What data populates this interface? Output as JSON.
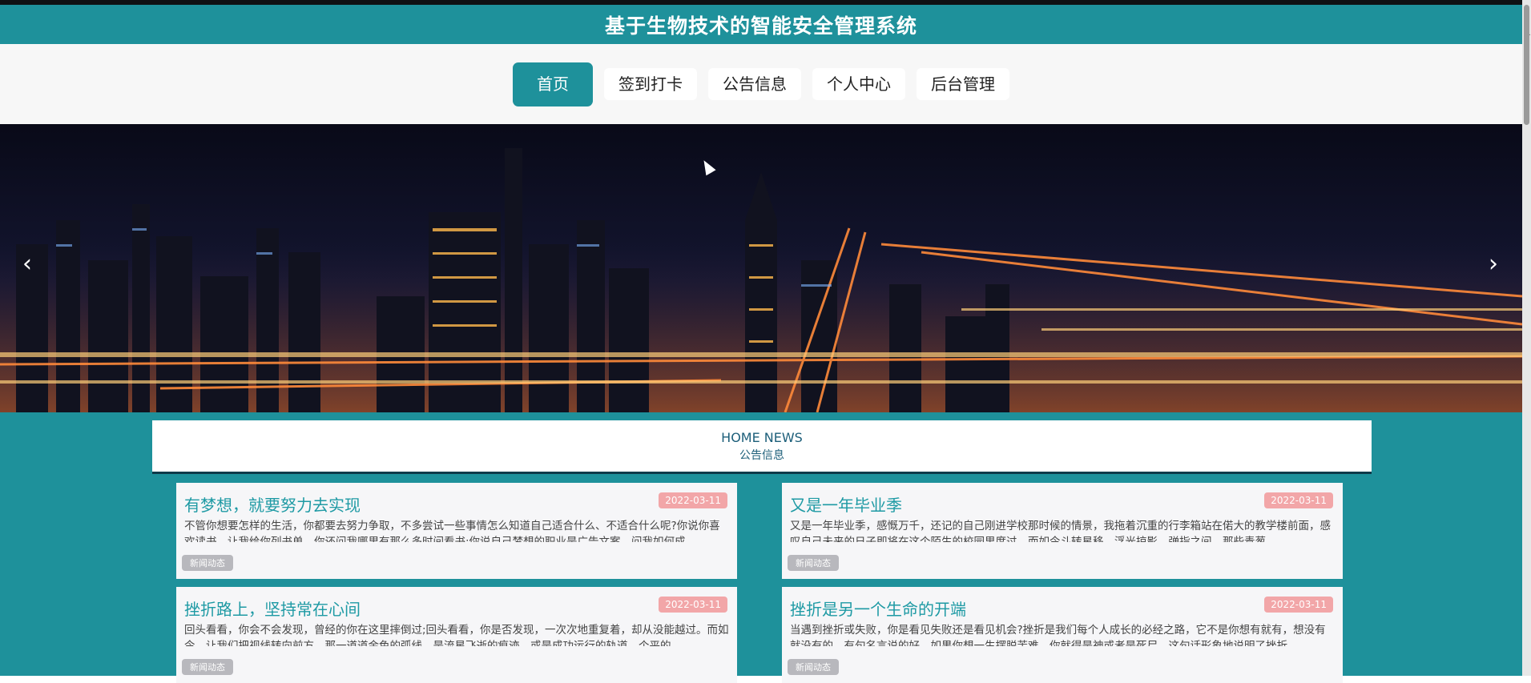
{
  "header": {
    "title": "基于生物技术的智能安全管理系统"
  },
  "nav": {
    "items": [
      {
        "label": "首页"
      },
      {
        "label": "签到打卡"
      },
      {
        "label": "公告信息"
      },
      {
        "label": "个人中心"
      },
      {
        "label": "后台管理"
      }
    ],
    "active_index": 0
  },
  "banner": {
    "prev_symbol": "‹",
    "next_symbol": "›"
  },
  "news": {
    "heading_en": "HOME NEWS",
    "heading_cn": "公告信息",
    "cards": [
      {
        "title": "有梦想，就要努力去实现",
        "date": "2022-03-11",
        "text": "不管你想要怎样的生活，你都要去努力争取，不多尝试一些事情怎么知道自己适合什么、不适合什么呢?你说你喜欢读书，让我给你列书单，你还问我哪里有那么多时间看书;你说自己梦想的职业是广告文案，问我如何成",
        "tag": "新闻动态"
      },
      {
        "title": "又是一年毕业季",
        "date": "2022-03-11",
        "text": "又是一年毕业季，感慨万千，还记的自己刚进学校那时候的情景，我拖着沉重的行李箱站在偌大的教学楼前面，感叹自己未来的日子即将在这个陌生的校园里度过，而如今斗转星移，浮光掠影，弹指之间，那些青葱",
        "tag": "新闻动态"
      },
      {
        "title": "挫折路上，坚持常在心间",
        "date": "2022-03-11",
        "text": "回头看看，你会不会发现，曾经的你在这里摔倒过;回头看看，你是否发现，一次次地重复着，却从没能越过。而如今，让我们把视线转向前方，那一道道金色的弧线，是流星飞逝的痕迹，或是成功运行的轨道，个平的",
        "tag": "新闻动态"
      },
      {
        "title": "挫折是另一个生命的开端",
        "date": "2022-03-11",
        "text": "当遇到挫折或失败，你是看见失败还是看见机会?挫折是我们每个人成长的必经之路，它不是你想有就有，想没有就没有的。有句名言说的好，如果你想一生摆脱苦难，你就得是神或者是死尸，这句话形象地说明了挫折",
        "tag": "新闻动态"
      }
    ]
  }
}
